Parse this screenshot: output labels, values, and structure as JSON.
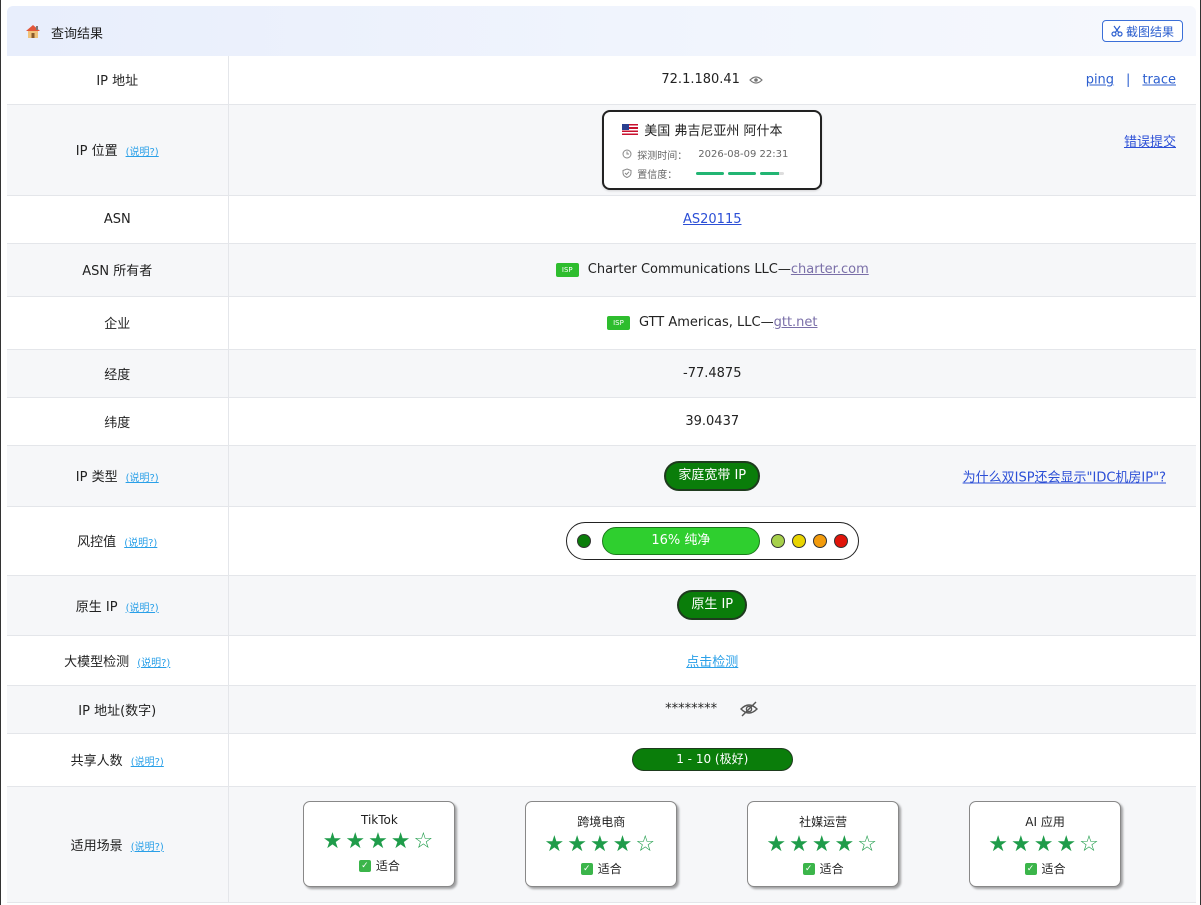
{
  "header": {
    "title": "查询结果",
    "screenshot_label": "截图结果"
  },
  "help_label": "(说明?)",
  "rows": {
    "ip": {
      "label": "IP 地址",
      "value": "72.1.180.41",
      "ping": "ping",
      "sep": "|",
      "trace": "trace"
    },
    "location": {
      "label": "IP 位置",
      "place": "美国 弗吉尼亚州 阿什本",
      "time_label": "探测时间：",
      "time": "2026-08-09 22:31",
      "conf_label": "置信度：",
      "report": "错误提交"
    },
    "asn": {
      "label": "ASN",
      "value": "AS20115"
    },
    "asn_owner": {
      "label": "ASN 所有者",
      "badge": "ISP",
      "name": "Charter Communications LLC—",
      "domain": "charter.com"
    },
    "company": {
      "label": "企业",
      "badge": "ISP",
      "name": "GTT Americas, LLC—",
      "domain": "gtt.net"
    },
    "longitude": {
      "label": "经度",
      "value": "-77.4875"
    },
    "latitude": {
      "label": "纬度",
      "value": "39.0437"
    },
    "ip_type": {
      "label": "IP 类型",
      "value": "家庭宽带 IP",
      "why": "为什么双ISP还会显示\"IDC机房IP\"?"
    },
    "risk": {
      "label": "风控值",
      "value": "16%  纯净",
      "percent": 16
    },
    "native": {
      "label": "原生 IP",
      "value": "原生 IP"
    },
    "llm": {
      "label": "大模型检测",
      "value": "点击检测"
    },
    "ip_numeric": {
      "label": "IP 地址(数字)",
      "value": "********"
    },
    "share": {
      "label": "共享人数",
      "value": "1 - 10 (极好)"
    },
    "scenes": {
      "label": "适用场景",
      "items": [
        {
          "name": "TikTok",
          "stars": "★★★★☆",
          "rating": 4,
          "ok": "适合"
        },
        {
          "name": "跨境电商",
          "stars": "★★★★☆",
          "rating": 4,
          "ok": "适合"
        },
        {
          "name": "社媒运营",
          "stars": "★★★★☆",
          "rating": 4,
          "ok": "适合"
        },
        {
          "name": "AI 应用",
          "stars": "★★★★☆",
          "rating": 4,
          "ok": "适合"
        }
      ]
    }
  },
  "colors": {
    "accent": "#2c5fcf",
    "green": "#0a7d0a",
    "bright_green": "#2fcf2f",
    "star": "#1f9c4a"
  },
  "risk_dots": [
    "#0a7d0a",
    "#a6d04a",
    "#e8d400",
    "#f29b0c",
    "#e0150a"
  ]
}
